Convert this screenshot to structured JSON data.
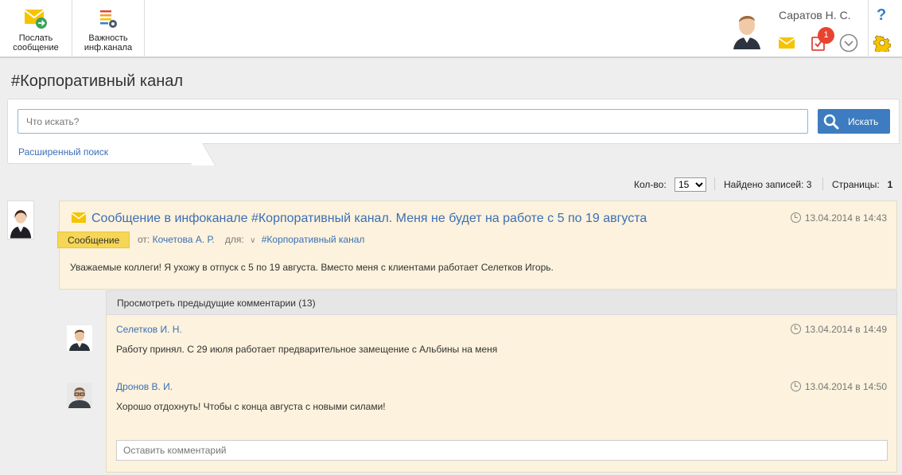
{
  "toolbar": {
    "send_label_1": "Послать",
    "send_label_2": "сообщение",
    "importance_label_1": "Важность",
    "importance_label_2": "инф.канала"
  },
  "user": {
    "name": "Саратов Н. С.",
    "tasks_badge": "1",
    "help": "?"
  },
  "page": {
    "title": "#Корпоративный канал"
  },
  "search": {
    "placeholder": "Что искать?",
    "button_label": "Искать",
    "advanced_link": "Расширенный поиск"
  },
  "pager": {
    "count_label": "Кол-во:",
    "count_value": "15",
    "count_options": [
      "15"
    ],
    "found_label": "Найдено записей: 3",
    "pages_label": "Страницы:",
    "current_page": "1"
  },
  "post": {
    "title": "Сообщение в инфоканале #Корпоративный канал. Меня не будет на работе с 5 по 19 августа",
    "time": "13.04.2014 в 14:43",
    "tag": "Сообщение",
    "from_label": "от:",
    "author": "Кочетова А. Р.",
    "for_label": "для:",
    "channel": "#Корпоративный канал",
    "body": "Уважаемые коллеги! Я ухожу в отпуск с 5 по 19 августа. Вместо меня с клиентами работает Селетков Игорь."
  },
  "comments": {
    "prev_label": "Просмотреть предыдущие комментарии (13)",
    "items": [
      {
        "author": "Селетков И. Н.",
        "time": "13.04.2014 в 14:49",
        "text": "Работу принял. С 29 июля работает предварительное замещение с Альбины на меня"
      },
      {
        "author": "Дронов В. И.",
        "time": "13.04.2014 в 14:50",
        "text": "Хорошо отдохнуть! Чтобы с конца августа с новыми силами!"
      }
    ],
    "input_placeholder": "Оставить комментарий"
  },
  "colors": {
    "accent": "#3b6fb6",
    "post_bg": "#fcf2dd",
    "tag_bg": "#f7d656",
    "search_button": "#3d7cc0",
    "badge": "#e8432f"
  }
}
